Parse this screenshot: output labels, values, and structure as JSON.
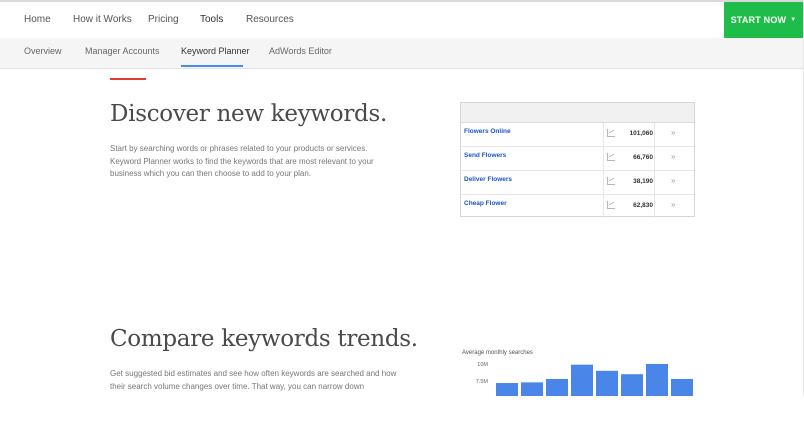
{
  "topnav": {
    "items": [
      "Home",
      "How it Works",
      "Pricing",
      "Tools",
      "Resources"
    ],
    "active": "Tools",
    "cta_label": "START NOW",
    "cta_icon": "caret-down-icon"
  },
  "subnav": {
    "items": [
      "Overview",
      "Manager Accounts",
      "Keyword Planner",
      "AdWords Editor"
    ],
    "active": "Keyword Planner"
  },
  "section1": {
    "heading": "Discover new keywords.",
    "body": "Start by searching words or phrases related to your products or services. Keyword Planner works to find the keywords that are most relevant to your business which you can then choose to add to your plan."
  },
  "keyword_table": {
    "rows": [
      {
        "keyword": "Flowers Online",
        "searches": "101,060"
      },
      {
        "keyword": "Send Flowers",
        "searches": "66,760"
      },
      {
        "keyword": "Deliver Flowers",
        "searches": "38,190"
      },
      {
        "keyword": "Cheap Flower",
        "searches": "62,830"
      }
    ],
    "row_icon": "trend-chart-icon",
    "row_action_icon": "double-chevron-right-icon"
  },
  "section2": {
    "heading": "Compare keywords trends.",
    "body": "Get suggested bid estimates and see how often keywords are searched and how their search volume changes over time. That way, you can narrow down"
  },
  "chart_data": {
    "type": "bar",
    "title": "Average monthly searches",
    "ytick_labels": [
      "10M",
      "7.5M"
    ],
    "yticks": [
      10,
      7.5
    ],
    "ylim": [
      0,
      10.5
    ],
    "categories": [
      "",
      "",
      "",
      "",
      "",
      "",
      "",
      ""
    ],
    "values": [
      7.2,
      7.3,
      7.8,
      9.9,
      9.0,
      8.5,
      10.0,
      7.8
    ],
    "colors": {
      "bar": "#4a86e8"
    }
  }
}
